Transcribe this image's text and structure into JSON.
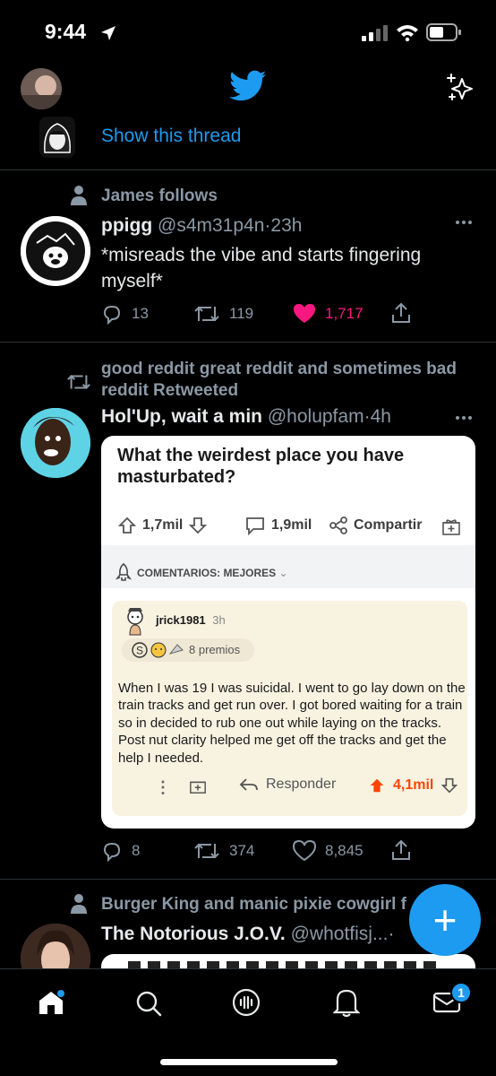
{
  "status": {
    "time": "9:44"
  },
  "thread_link": {
    "label": "Show this thread"
  },
  "tweet1": {
    "context": "James follows",
    "display_name": "ppigg",
    "handle": "@s4m31p4n",
    "sep": "·",
    "age": "23h",
    "text_line1": "*misreads the vibe and starts fingering",
    "text_line2": "myself*",
    "replies": "13",
    "retweets": "119",
    "likes": "1,717"
  },
  "tweet2": {
    "context_line1": "good reddit great reddit and sometimes bad",
    "context_line2": "reddit Retweeted",
    "display_name": "Hol'Up, wait a min",
    "handle": "@holupfam",
    "sep": "·",
    "age": "4h",
    "replies": "8",
    "retweets": "374",
    "likes": "8,845",
    "card": {
      "question": "What the weirdest place you have masturbated?",
      "upvotes": "1,7mil",
      "comments": "1,9mil",
      "share": "Compartir",
      "sort_label": "COMENTARIOS: MEJORES",
      "commenter": "jrick1981",
      "comment_age": "3h",
      "awards": "8 premios",
      "comment_text": "When I was 19 I was suicidal. I went to go lay down on the train tracks and get run over. I got bored waiting for a train so in decided to rub one out while laying on the tracks. Post nut clarity helped me get off the tracks and get the help I needed.",
      "reply_label": "Responder",
      "comment_score": "4,1mil"
    }
  },
  "tweet3": {
    "context": "Burger King and manic pixie cowgirl f",
    "display_name": "The Notorious J.O.V.",
    "handle": "@whotfisj...",
    "sep": "·"
  },
  "fab": {
    "label": "+"
  },
  "tabbar": {
    "messages_badge": "1"
  },
  "colors": {
    "accent": "#1d9bf0",
    "like": "#f91880",
    "reddit_orange": "#ff4500"
  },
  "icons": [
    "twitter-bird-icon",
    "sparkle-icon",
    "person-icon",
    "retweet-icon",
    "reply-icon",
    "heart-icon",
    "share-icon",
    "more-icon",
    "home-icon",
    "search-icon",
    "spaces-icon",
    "bell-icon",
    "mail-icon"
  ]
}
